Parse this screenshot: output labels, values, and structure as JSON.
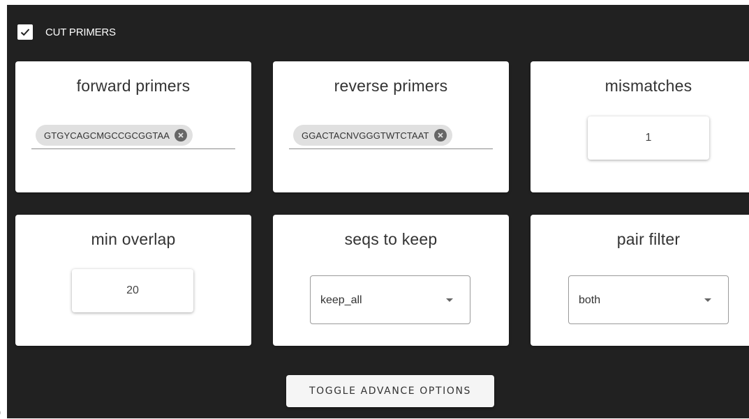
{
  "stray_char": ")",
  "header": {
    "label": "CUT PRIMERS",
    "checked": true
  },
  "cards": {
    "forward_primers": {
      "title": "forward primers",
      "chips": [
        "GTGYCAGCMGCCGCGGTAA"
      ]
    },
    "reverse_primers": {
      "title": "reverse primers",
      "chips": [
        "GGACTACNVGGGTWTCTAAT"
      ]
    },
    "mismatches": {
      "title": "mismatches",
      "value": "1"
    },
    "min_overlap": {
      "title": "min overlap",
      "value": "20"
    },
    "seqs_to_keep": {
      "title": "seqs to keep",
      "value": "keep_all"
    },
    "pair_filter": {
      "title": "pair filter",
      "value": "both"
    }
  },
  "toggle_button": {
    "label": "TOGGLE ADVANCE OPTIONS"
  },
  "colors": {
    "panel_bg": "#212121",
    "card_bg": "#ffffff",
    "chip_bg": "#e0e0e0"
  },
  "icons": {
    "checkbox": "check-icon",
    "chip_remove": "close-circle-icon",
    "dropdown": "caret-down-icon"
  }
}
